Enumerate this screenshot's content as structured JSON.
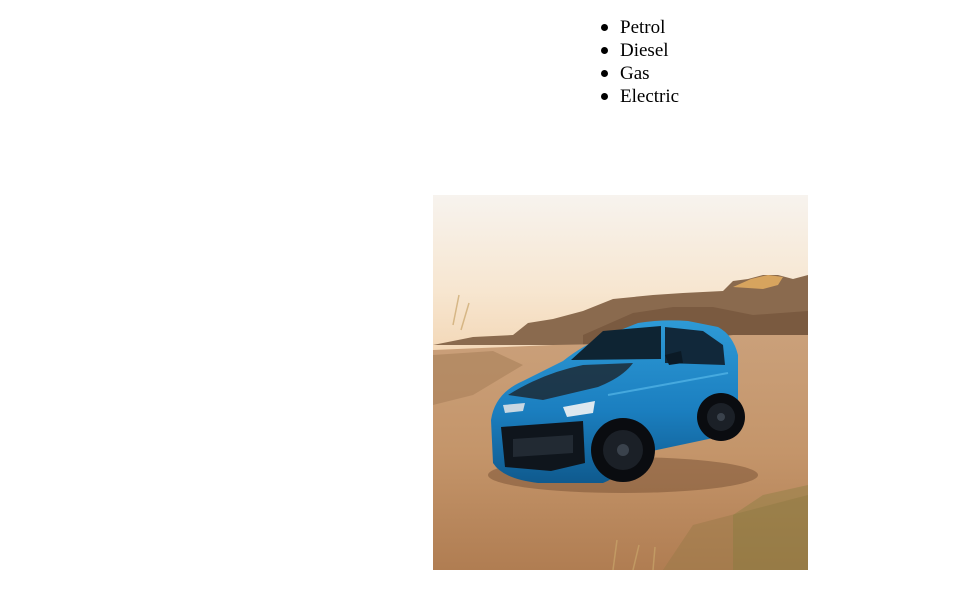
{
  "fuel_types": {
    "items": [
      {
        "label": "Petrol"
      },
      {
        "label": "Diesel"
      },
      {
        "label": "Gas"
      },
      {
        "label": "Electric"
      }
    ]
  },
  "car_image": {
    "subject": "blue-sports-car",
    "colors": {
      "car_body": "#1b7fc0",
      "sky": "#f6efe3",
      "ground": "#c99a6a"
    }
  }
}
